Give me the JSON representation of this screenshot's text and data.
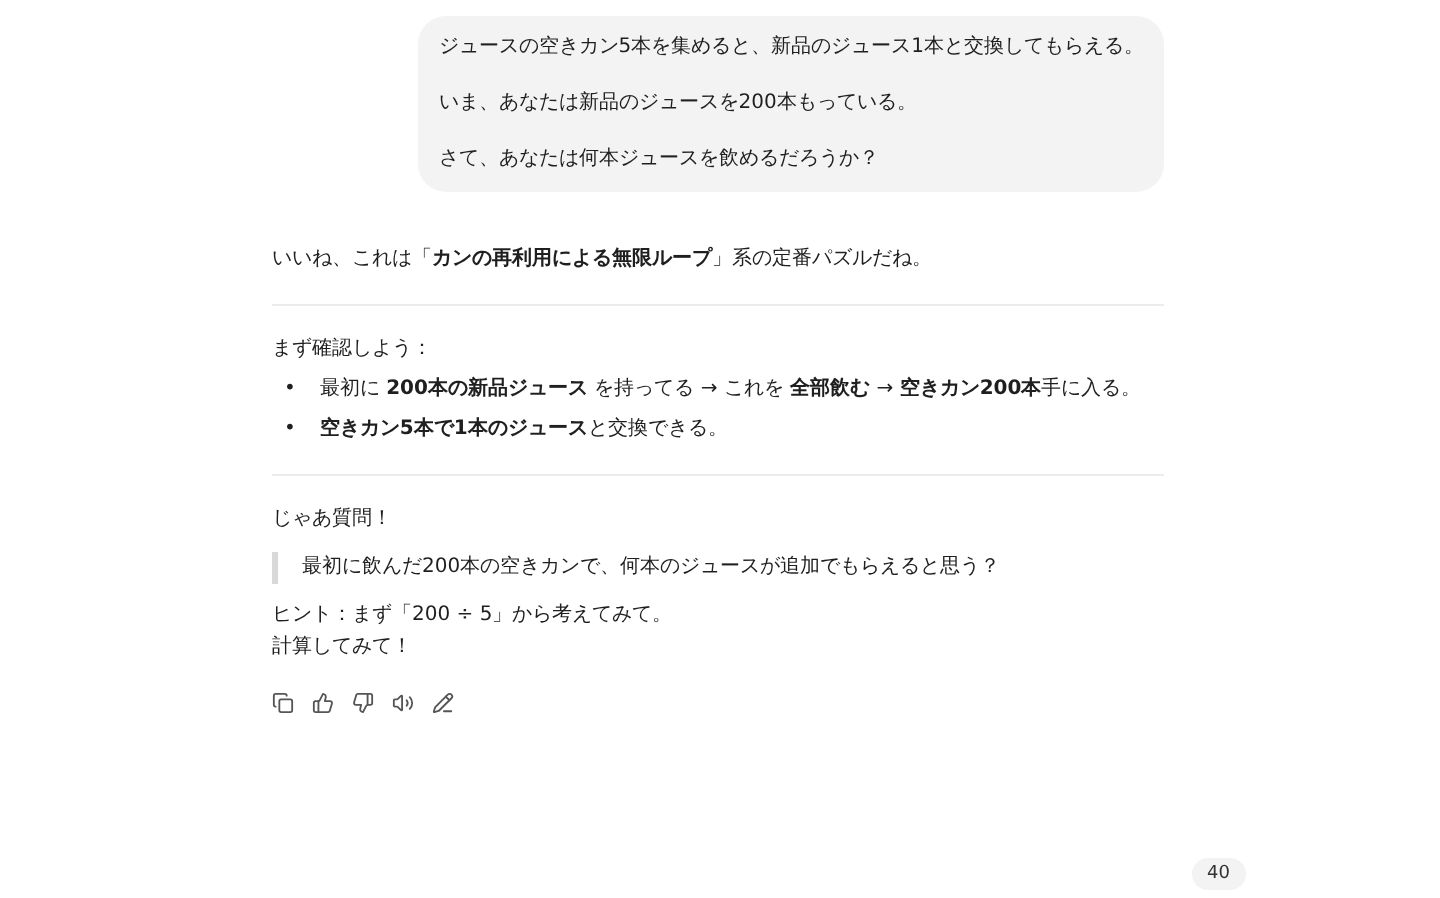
{
  "user_message": {
    "paragraphs": [
      "ジュースの空きカン5本を集めると、新品のジュース1本と交換してもらえる。",
      "いま、あなたは新品のジュースを200本もっている。",
      "さて、あなたは何本ジュースを飲めるだろうか？"
    ]
  },
  "assistant_message": {
    "sections": [
      {
        "kind": "paragraph",
        "text": "いいね、これは「**カンの再利用による無限ループ**」系の定番パズルだね。"
      },
      {
        "kind": "divider"
      },
      {
        "kind": "paragraph",
        "text": "まず確認しよう："
      },
      {
        "kind": "bullets",
        "items": [
          {
            "marker": "•",
            "text": "最初に **200本の新品ジュース** を持ってる → これを **全部飲む** → **空きカン200本**手に入る。"
          },
          {
            "marker": "•",
            "text": "**空きカン5本で1本のジュース**と交換できる。"
          }
        ]
      },
      {
        "kind": "divider"
      },
      {
        "kind": "paragraph",
        "text": "じゃあ質問！"
      },
      {
        "kind": "quote",
        "text": "最初に飲んだ200本の空きカンで、何本のジュースが追加でもらえると思う？"
      },
      {
        "kind": "lines",
        "items": [
          "ヒント：まず「200 ÷ 5」から考えてみて。",
          "計算してみて！"
        ]
      }
    ]
  },
  "counter": "40"
}
